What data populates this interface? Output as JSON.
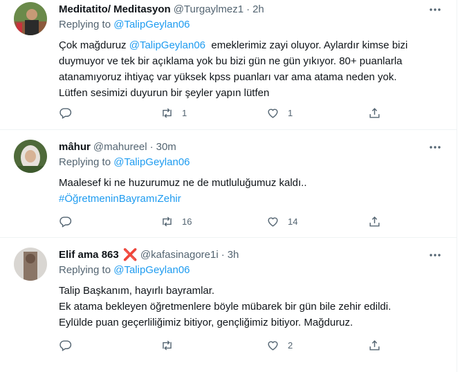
{
  "tweets": [
    {
      "name": "Meditatito/ Meditasyon",
      "handle": "@Turgaylmez1",
      "separator": "·",
      "time": "2h",
      "replying_prefix": "Replying to ",
      "replying_to": "@TalipGeylan06",
      "text_lines": [
        {
          "pre": "Çok mağduruz ",
          "mention": "@TalipGeylan06",
          "post": "  emeklerimiz zayi oluyor. Aylardır kimse bizi"
        },
        {
          "text": "duymuyor ve tek bir açıklama yok bu bizi gün ne gün yıkıyor. 80+ puanlarla"
        },
        {
          "text": "atanamıyoruz ihtiyaç var yüksek kpss puanları var ama atama neden yok."
        },
        {
          "text": "Lütfen sesimizi duyurun bir şeyler yapın lütfen"
        }
      ],
      "replies": "",
      "retweets": "1",
      "likes": "1"
    },
    {
      "name": "mâhur",
      "handle": "@mahureel",
      "separator": "·",
      "time": "30m",
      "replying_prefix": "Replying to ",
      "replying_to": "@TalipGeylan06",
      "text_lines": [
        {
          "text": "Maalesef ki ne huzurumuz ne de mutluluğumuz kaldı.."
        },
        {
          "hashtag": "#ÖğretmeninBayramıZehir"
        }
      ],
      "replies": "",
      "retweets": "16",
      "likes": "14"
    },
    {
      "name": "Elif ama 863",
      "name_badge": "❌",
      "handle": "@kafasinagore1i",
      "separator": "·",
      "time": "3h",
      "replying_prefix": "Replying to ",
      "replying_to": "@TalipGeylan06",
      "text_lines": [
        {
          "text": "Talip Başkanım, hayırlı bayramlar."
        },
        {
          "text": "Ek atama bekleyen öğretmenlere böyle mübarek bir gün bile zehir edildi."
        },
        {
          "text": "Eylülde puan geçerliliğimiz bitiyor, gençliğimiz bitiyor. Mağduruz."
        }
      ],
      "replies": "",
      "retweets": "",
      "likes": "2"
    }
  ],
  "icons": {
    "reply": "reply-icon",
    "retweet": "retweet-icon",
    "like": "heart-icon",
    "share": "share-icon",
    "more": "more-icon"
  },
  "colors": {
    "link": "#1d9bf0",
    "secondary_text": "#536471",
    "primary_text": "#0f1419",
    "divider": "#eff3f4",
    "badge_red": "#e0245e"
  }
}
